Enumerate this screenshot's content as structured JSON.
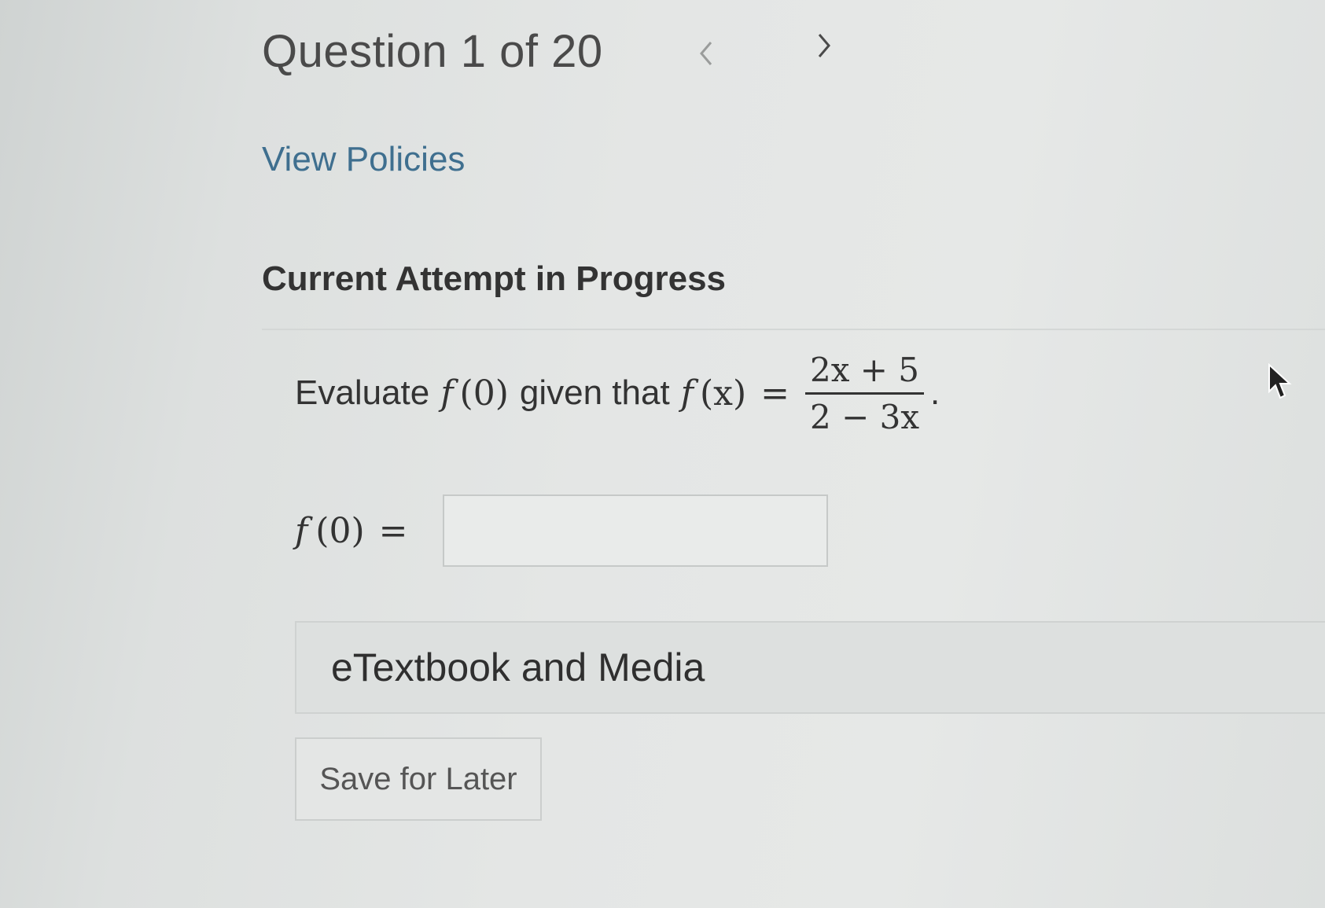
{
  "header": {
    "question_counter": "Question 1 of 20",
    "prev_icon": "chevron-left-icon",
    "next_icon": "chevron-right-icon"
  },
  "links": {
    "view_policies": "View Policies"
  },
  "attempt": {
    "heading": "Current Attempt in Progress"
  },
  "question": {
    "prompt_prefix": "Evaluate",
    "f_label": "f",
    "eval_arg": "(0)",
    "mid_text": "given that",
    "fx": "(x)",
    "equals": "=",
    "numerator": "2x + 5",
    "denominator": "2 − 3x",
    "end_punct": "."
  },
  "answer": {
    "label_f": "f",
    "label_arg": "(0)",
    "equals": "=",
    "value": "",
    "placeholder": ""
  },
  "media": {
    "title": "eTextbook and Media"
  },
  "actions": {
    "save_label": "Save for Later"
  },
  "colors": {
    "link": "#3f6f8f",
    "text": "#333333",
    "background": "#e4e6e5"
  }
}
